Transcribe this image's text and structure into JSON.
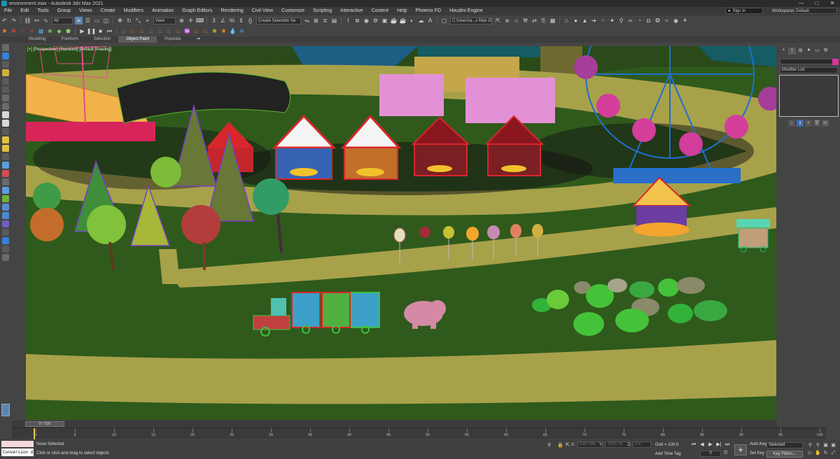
{
  "window": {
    "title": "environment.max - Autodesk 3ds Max 2021",
    "controls": [
      "—",
      "□",
      "✕"
    ]
  },
  "menu": {
    "items": [
      "File",
      "Edit",
      "Tools",
      "Group",
      "Views",
      "Create",
      "Modifiers",
      "Animation",
      "Graph Editors",
      "Rendering",
      "Civil View",
      "Customize",
      "Scripting",
      "Interactive",
      "Content",
      "Help",
      "Phoenix FD",
      "Houdini Engine"
    ],
    "sign_in": "Sign In",
    "workspaces_label": "Workspaces:",
    "workspace_value": "Default"
  },
  "toolbar": {
    "filter_value": "All",
    "refcoord_value": "View",
    "selection_set": "Create Selection Se",
    "project_path": "C:\\Users\\a...s Max 2021"
  },
  "ribbon": {
    "tabs": [
      "Modeling",
      "Freeform",
      "Selection",
      "Object Paint",
      "Populate"
    ],
    "active": "Object Paint"
  },
  "viewport": {
    "label": "[+] [Perspective] [Standard] [Default Shading]"
  },
  "command_panel": {
    "modifier_list": "Modifier List"
  },
  "time_slider": {
    "position": "0 / 100"
  },
  "trackbar": {
    "labels": [
      "0",
      "5",
      "10",
      "15",
      "20",
      "25",
      "30",
      "35",
      "40",
      "45",
      "50",
      "55",
      "60",
      "65",
      "70",
      "75",
      "80",
      "85",
      "90",
      "95",
      "100"
    ]
  },
  "status": {
    "maxscript_text": "Conversion d",
    "selection_text": "None Selected",
    "prompt_text": "Click or click-and-drag to select objects",
    "x_label": "X:",
    "y_label": "Y:",
    "z_label": "Z:",
    "x_value": "2031.386",
    "y_value": "-2031.34",
    "z_value": "0.0",
    "grid": "Grid = 100,0",
    "add_time_tag": "Add Time Tag",
    "frame": "0",
    "auto_key": "Auto Key",
    "set_key": "Set Key",
    "selected_value": "Selected",
    "key_filters": "Key Filters..."
  },
  "colors": {
    "grass": "#2f5a1c",
    "path": "#a8a84a",
    "sky": "#155c63",
    "accent": "#1c8fb3"
  }
}
